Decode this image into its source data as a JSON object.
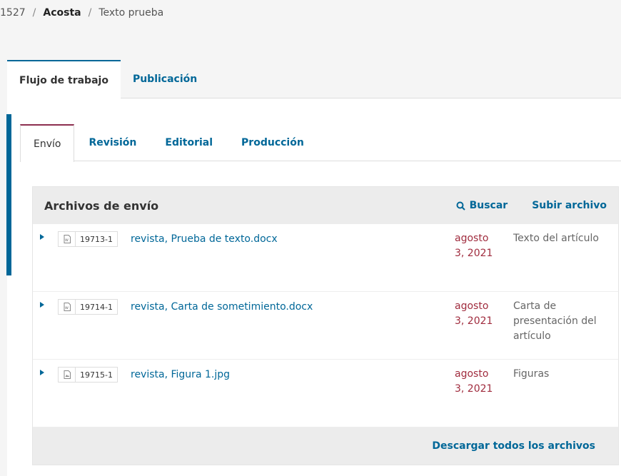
{
  "breadcrumb": {
    "id": "1527",
    "sep": "/",
    "author": "Acosta",
    "title": "Texto prueba"
  },
  "main_tabs": [
    {
      "label": "Flujo de trabajo",
      "active": true
    },
    {
      "label": "Publicación",
      "active": false
    }
  ],
  "sub_tabs": [
    {
      "label": "Envío",
      "active": true
    },
    {
      "label": "Revisión",
      "active": false
    },
    {
      "label": "Editorial",
      "active": false
    },
    {
      "label": "Producción",
      "active": false
    }
  ],
  "grid": {
    "title": "Archivos de envío",
    "search_label": "Buscar",
    "upload_label": "Subir archivo",
    "rows": [
      {
        "id": "19713-1",
        "icon": "word-doc-icon",
        "name": "revista, Prueba de texto.docx",
        "date": "agosto 3, 2021",
        "type": "Texto del artículo"
      },
      {
        "id": "19714-1",
        "icon": "word-doc-icon",
        "name": "revista, Carta de sometimiento.docx",
        "date": "agosto 3, 2021",
        "type": "Carta de presentación del artículo"
      },
      {
        "id": "19715-1",
        "icon": "image-file-icon",
        "name": "revista, Figura 1.jpg",
        "date": "agosto 3, 2021",
        "type": "Figuras"
      }
    ],
    "download_all_label": "Descargar todos los archivos"
  },
  "colors": {
    "accent": "#006798",
    "date": "#a02c3e",
    "subtab_active": "#8c2e4f"
  }
}
